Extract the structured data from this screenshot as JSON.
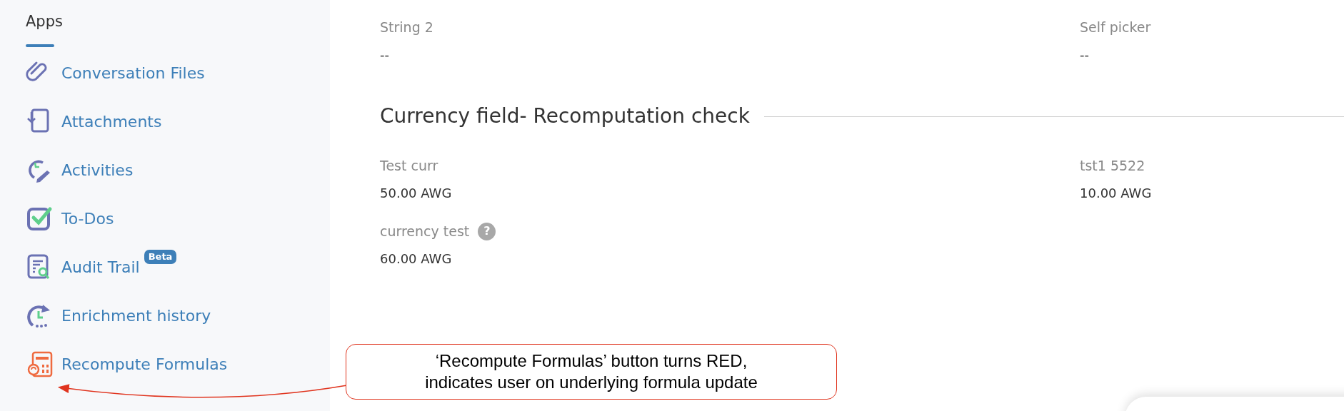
{
  "sidebar": {
    "title": "Apps",
    "items": [
      {
        "label": "Conversation Files",
        "kind": "paperclip"
      },
      {
        "label": "Attachments",
        "kind": "attachment"
      },
      {
        "label": "Activities",
        "kind": "activity"
      },
      {
        "label": "To-Dos",
        "kind": "todo"
      },
      {
        "label": "Audit Trail",
        "kind": "audit",
        "badge": "Beta"
      },
      {
        "label": "Enrichment history",
        "kind": "history"
      },
      {
        "label": "Recompute Formulas",
        "kind": "recompute"
      }
    ]
  },
  "fields_top": [
    {
      "label": "String 2",
      "value": "--"
    },
    {
      "label": "Self picker",
      "value": "--"
    }
  ],
  "section": {
    "title": "Currency field- Recomputation check",
    "fields": [
      {
        "label": "Test curr",
        "value": "50.00 AWG"
      },
      {
        "label": "tst1 5522",
        "value": "10.00 AWG"
      },
      {
        "label": "currency test",
        "value": "60.00 AWG",
        "help": "?"
      }
    ]
  },
  "annotation": {
    "lines": [
      "‘Recompute Formulas’ button turns RED,",
      "indicates user on underlying formula update"
    ]
  }
}
